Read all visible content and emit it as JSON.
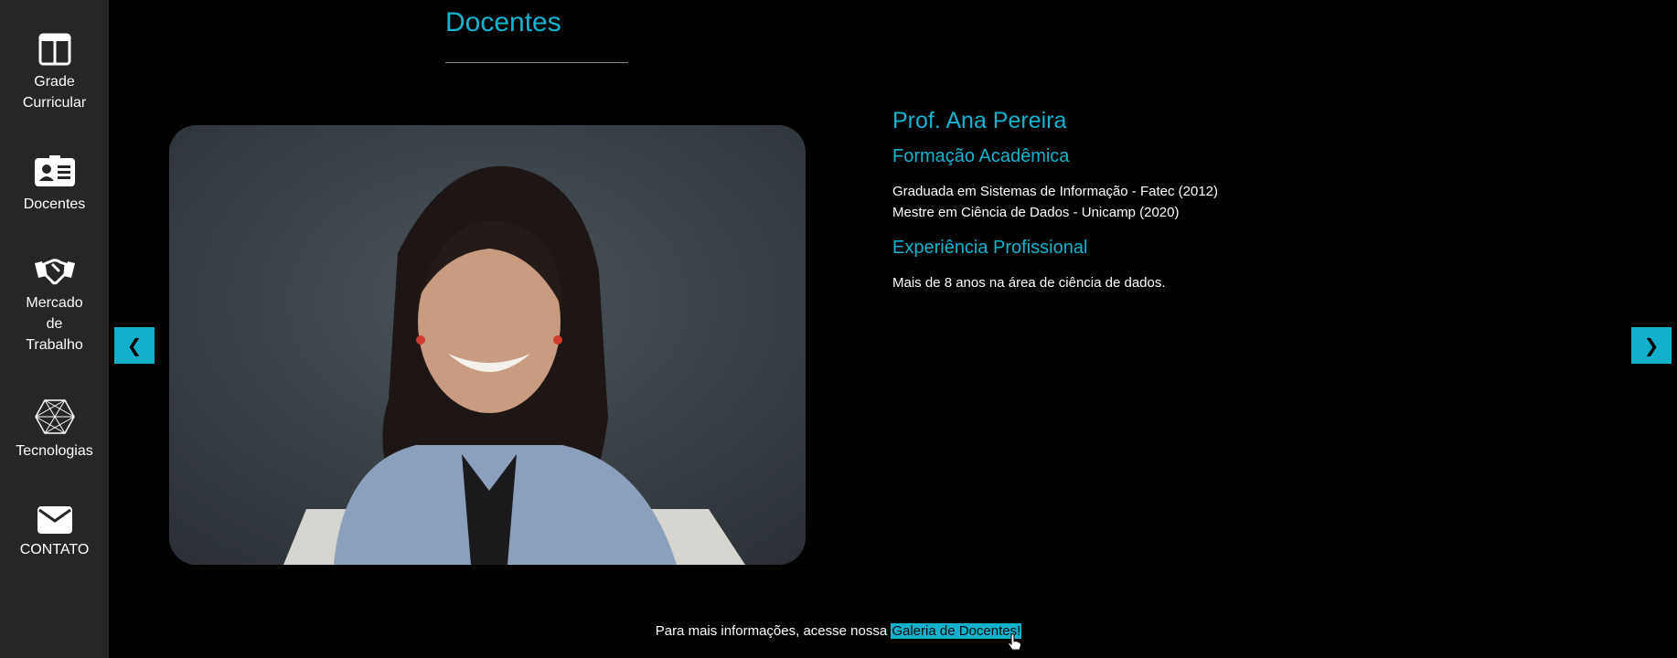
{
  "sidebar": {
    "items": [
      {
        "label": "Grade\nCurricular",
        "icon": "columns-icon"
      },
      {
        "label": "Docentes",
        "icon": "id-card-icon"
      },
      {
        "label": "Mercado\nde\nTrabalho",
        "icon": "handshake-icon"
      },
      {
        "label": "Tecnologias",
        "icon": "polyhedron-icon"
      },
      {
        "label": "CONTATO",
        "icon": "envelope-icon"
      }
    ]
  },
  "header": {
    "title": "Docentes"
  },
  "carousel": {
    "prev_label": "❮",
    "next_label": "❯",
    "professor": {
      "name": "Prof. Ana Pereira",
      "education_title": "Formação Acadêmica",
      "education": [
        "Graduada em Sistemas de Informação - Fatec (2012)",
        "Mestre em Ciência de Dados - Unicamp (2020)"
      ],
      "experience_title": "Experiência Profissional",
      "experience": "Mais de 8 anos na área de ciência de dados."
    }
  },
  "footer": {
    "text": "Para mais informações, acesse nossa ",
    "link_label": "Galeria de Docentes!"
  },
  "colors": {
    "accent": "#14b3cf",
    "sidebar": "#262626",
    "background": "#000000"
  }
}
